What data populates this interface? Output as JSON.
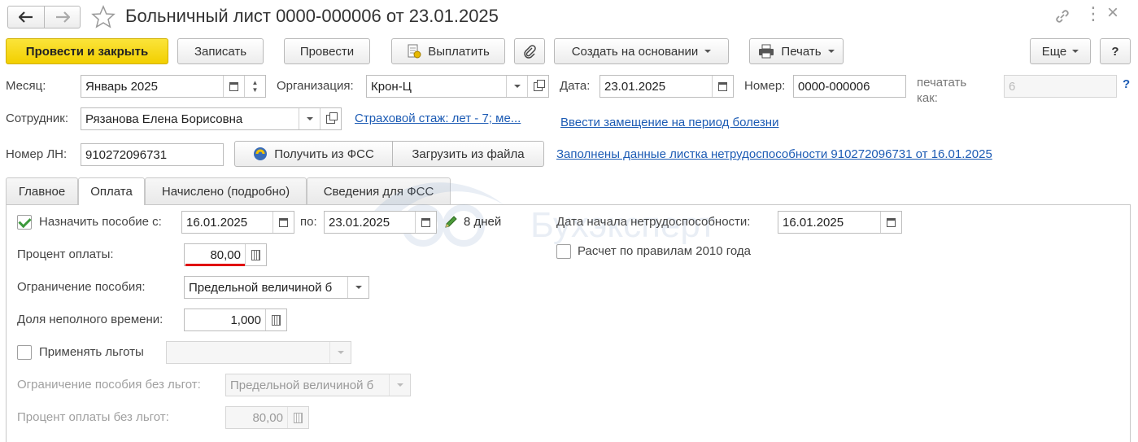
{
  "window": {
    "title": "Больничный лист 0000-000006 от 23.01.2025"
  },
  "toolbar": {
    "post_close": "Провести и закрыть",
    "save": "Записать",
    "post": "Провести",
    "pay": "Выплатить",
    "create_based": "Создать на основании",
    "print": "Печать",
    "more": "Еще",
    "help": "?"
  },
  "header": {
    "month_label": "Месяц:",
    "month_value": "Январь 2025",
    "org_label": "Организация:",
    "org_value": "Крон-Ц",
    "date_label": "Дата:",
    "date_value": "23.01.2025",
    "number_label": "Номер:",
    "number_value": "0000-000006",
    "print_as_label": "печатать как:",
    "print_as_value": "6",
    "help_q": "?",
    "employee_label": "Сотрудник:",
    "employee_value": "Рязанова Елена Борисовна",
    "insurance_link": "Страховой стаж: лет - 7; ме...",
    "replacement_link": "Ввести замещение на период болезни",
    "ln_label": "Номер ЛН:",
    "ln_value": "910272096731",
    "get_fss": "Получить из ФСС",
    "load_file": "Загрузить из файла",
    "filled_link": "Заполнены данные листка нетрудоспособности 910272096731 от 16.01.2025"
  },
  "tabs": [
    {
      "label": "Главное"
    },
    {
      "label": "Оплата"
    },
    {
      "label": "Начислено (подробно)"
    },
    {
      "label": "Сведения для ФСС"
    }
  ],
  "payment": {
    "assign_label": "Назначить пособие с:",
    "assign_checked": true,
    "from_value": "16.01.2025",
    "to_label": "по:",
    "to_value": "23.01.2025",
    "days_text": "8 дней",
    "start_label": "Дата начала нетрудоспособности:",
    "start_value": "16.01.2025",
    "percent_label": "Процент оплаты:",
    "percent_value": "80,00",
    "rules2010_label": "Расчет по правилам 2010 года",
    "limit_label": "Ограничение пособия:",
    "limit_value": "Предельной величиной б",
    "partial_label": "Доля неполного времени:",
    "partial_value": "1,000",
    "benefits_label": "Применять льготы",
    "limit_nb_label": "Ограничение пособия без льгот:",
    "limit_nb_value": "Предельной величиной б",
    "percent_nb_label": "Процент оплаты без льгот:",
    "percent_nb_value": "80,00"
  },
  "watermark": "Бухэксперт",
  "colors": {
    "primary_button": "#f2cf00",
    "link": "#1c5bb4",
    "underline_mark": "#e00000",
    "check": "#3c9a3c"
  }
}
